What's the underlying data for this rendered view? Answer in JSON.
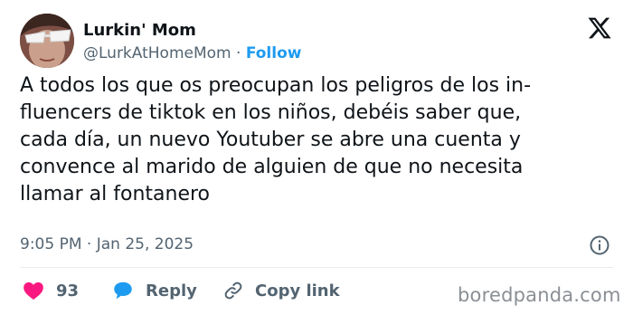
{
  "author": {
    "display_name": "Lurkin' Mom",
    "handle": "@LurkAtHomeMom",
    "separator": "·",
    "follow_label": "Follow",
    "avatar_icon": "profile-photo"
  },
  "logo_icon": "x-logo-icon",
  "tweet": {
    "text": "A todos los que os preocupan los peligros de los in-\nfluencers de tiktok en los niños, debéis saber que,\ncada día, un nuevo Youtuber se abre una cuenta y\nconvence al marido de alguien de que no necesita\nllamar al fontanero",
    "timestamp": "9:05 PM · Jan 25, 2025"
  },
  "actions": {
    "like_count": "93",
    "reply_label": "Reply",
    "copy_link_label": "Copy link"
  },
  "watermark": "boredpanda.com",
  "colors": {
    "like": "#f91880",
    "accent": "#1d9bf0",
    "secondary_text": "#536471"
  }
}
